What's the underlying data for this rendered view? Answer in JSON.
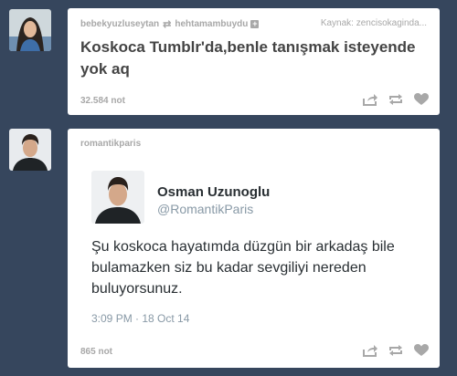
{
  "posts": [
    {
      "author": "bebekyuzluseytan",
      "reblogged_from": "hehtamambuydu",
      "source_label": "Kaynak: zencisokaginda...",
      "title": "Koskoca Tumblr'da,benle tanışmak isteyende yok aq",
      "notes": "32.584 not"
    },
    {
      "author": "romantikparis",
      "tweet": {
        "name": "Osman Uzunoglu",
        "handle": "@RomantikParis",
        "text": "Şu koskoca hayatımda düzgün bir arkadaş bile bulamazken siz bu kadar sevgiliyi nereden buluyorsunuz.",
        "timestamp": "3:09 PM · 18 Oct 14"
      },
      "notes": "865 not"
    }
  ],
  "icons": {
    "reblog": "reblog-arrows-icon",
    "share": "share-icon",
    "like": "heart-icon",
    "follow": "plus-square-icon"
  },
  "colors": {
    "dashboard_bg": "#36465d",
    "post_bg": "#ffffff",
    "meta_text": "#a8a8a8",
    "tweet_secondary": "#8899a6"
  }
}
